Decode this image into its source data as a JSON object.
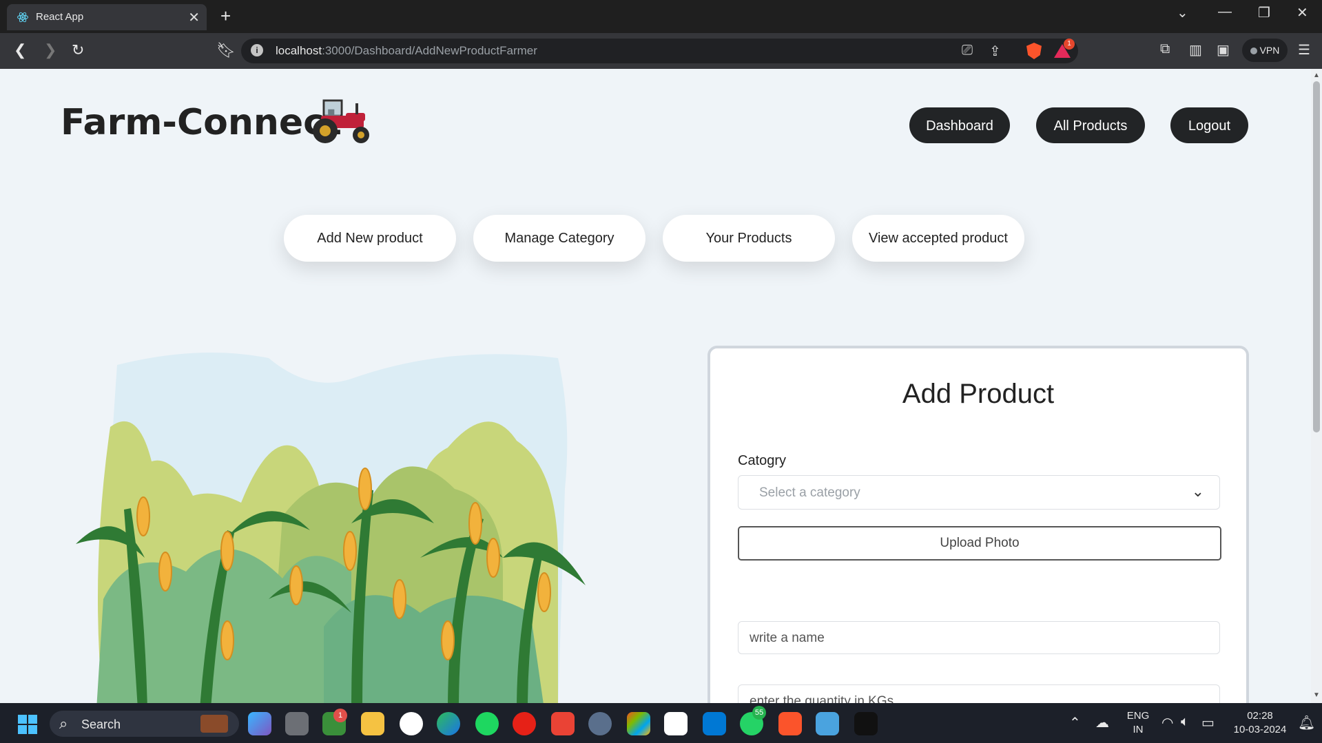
{
  "browser": {
    "tab_title": "React App",
    "tab_close": "✕",
    "new_tab": "+",
    "url_host": "localhost",
    "url_path": ":3000/Dashboard/AddNewProductFarmer",
    "rewards_count": "1",
    "vpn_label": "VPN"
  },
  "header": {
    "brand": "Farm-Connect",
    "nav": [
      "Dashboard",
      "All Products",
      "Logout"
    ]
  },
  "subnav": [
    "Add New product",
    "Manage Category",
    "Your Products",
    "View accepted product"
  ],
  "form": {
    "title": "Add Product",
    "category_label": "Catogry",
    "category_placeholder": "Select a category",
    "upload_label": "Upload Photo",
    "name_placeholder": "write a name",
    "quantity_placeholder": "enter the quantity in KGs"
  },
  "taskbar": {
    "search_label": "Search",
    "badge_app": "1",
    "badge_whatsapp": "55",
    "lang_line1": "ENG",
    "lang_line2": "IN",
    "time": "02:28",
    "date": "10-03-2024"
  },
  "colors": {
    "nav_dark": "#222426",
    "page_bg": "#eff4f8",
    "taskbar_bg": "#1c2029"
  }
}
